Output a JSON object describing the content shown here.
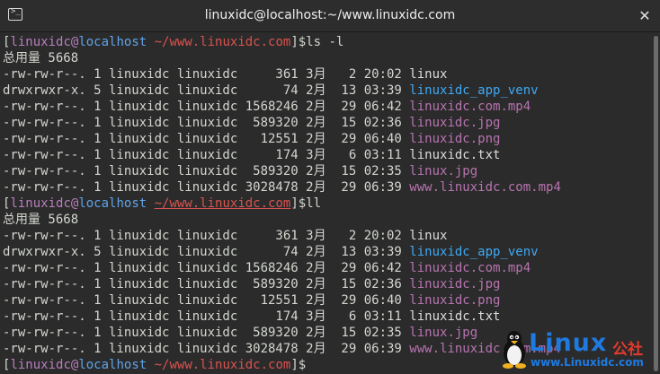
{
  "window": {
    "title": "linuxidc@localhost:~/www.linuxidc.com",
    "close_glyph": "✕",
    "icon_glyph": ">_"
  },
  "prompt1": {
    "user": "linuxidc",
    "at": "@",
    "host": "localhost",
    "dir": "~/www.linuxidc.com",
    "cmd": "ls -l"
  },
  "prompt2": {
    "user": "linuxidc",
    "at": "@",
    "host": "localhost",
    "dir": "~/www.linuxidc.com",
    "cmd": "ll"
  },
  "prompt3": {
    "user": "linuxidc",
    "at": "@",
    "host": "localhost",
    "dir": "~/www.linuxidc.com",
    "cmd": ""
  },
  "total_line": "总用量 5668",
  "listing": [
    {
      "meta": "-rw-rw-r--. 1 linuxidc linuxidc     361 3月   2 20:02 ",
      "name": "linux",
      "kind": "file"
    },
    {
      "meta": "drwxrwxr-x. 5 linuxidc linuxidc      74 2月  13 03:39 ",
      "name": "linuxidc_app_venv",
      "kind": "dir"
    },
    {
      "meta": "-rw-rw-r--. 1 linuxidc linuxidc 1568246 2月  29 06:42 ",
      "name": "linuxidc.com.mp4",
      "kind": "media"
    },
    {
      "meta": "-rw-rw-r--. 1 linuxidc linuxidc  589320 2月  15 02:36 ",
      "name": "linuxidc.jpg",
      "kind": "media"
    },
    {
      "meta": "-rw-rw-r--. 1 linuxidc linuxidc   12551 2月  29 06:40 ",
      "name": "linuxidc.png",
      "kind": "media"
    },
    {
      "meta": "-rw-rw-r--. 1 linuxidc linuxidc     174 3月   6 03:11 ",
      "name": "linuxidc.txt",
      "kind": "file"
    },
    {
      "meta": "-rw-rw-r--. 1 linuxidc linuxidc  589320 2月  15 02:35 ",
      "name": "linux.jpg",
      "kind": "media"
    },
    {
      "meta": "-rw-rw-r--. 1 linuxidc linuxidc 3028478 2月  29 06:39 ",
      "name": "www.linuxidc.com.mp4",
      "kind": "media"
    }
  ],
  "colors": {
    "dir": "#3fa9f5",
    "media": "#b774b0",
    "file": "#dcdcdc",
    "background": "#2b2b2b"
  },
  "watermark": {
    "brand": "Linux",
    "cn": "公社",
    "url": "www.Linuxidc.com"
  }
}
